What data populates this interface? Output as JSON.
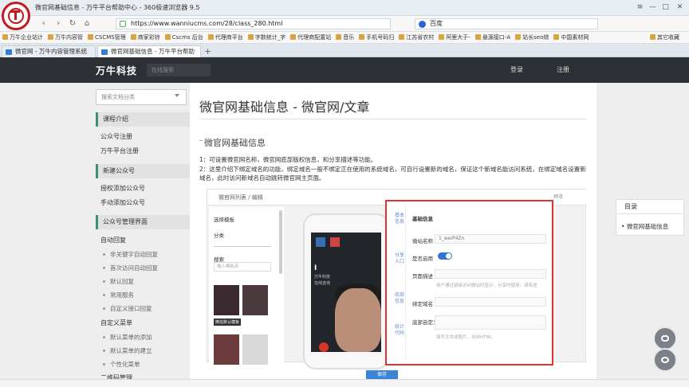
{
  "window": {
    "title": "微官网基础信息 - 万牛平台帮助中心 - 360极速浏览器 9.5",
    "menu_icon": "≡",
    "minimize": "—",
    "maximize": "□",
    "close": "✕"
  },
  "nav": {
    "url": "https://www.wanniucms.com/28/class_280.html",
    "search_engine": "百度",
    "back": "‹",
    "forward": "›",
    "reload": "↻",
    "home": "⌂"
  },
  "bookmarks": [
    "万牛企业站计",
    "万牛内容管",
    "CSCMS管理",
    "商家彩铃",
    "Cscms 后台",
    "代理商平台",
    "字数统计_字",
    "代理商配置站",
    "音乐",
    "手机号码归",
    "江苏省农村",
    "阿里大于-",
    "悬源接口-A",
    "站长seo综",
    "中国素材网",
    "其它收藏"
  ],
  "tabs": [
    "微官网 - 万牛内容管理系统",
    "微官网基础信息 - 万牛平台帮助"
  ],
  "site": {
    "brand": "万牛科技",
    "search_placeholder": "在线搜索",
    "login": "登录",
    "register": "注册"
  },
  "sidebar": {
    "category_select": "搜索文档分类",
    "sections": [
      {
        "title": "课程介绍",
        "items": [
          "公众号注册",
          "万牛平台注册"
        ]
      },
      {
        "title": "新建公众号",
        "items": [
          "授权添加公众号",
          "手动添加公众号"
        ]
      },
      {
        "title": "公众号管理界面",
        "items": []
      }
    ],
    "auto_reply": "自动回复",
    "auto_reply_items": [
      "非关键字自动回复",
      "首次访问自动回复",
      "默认回复",
      "常用服务",
      "自定义接口回复"
    ],
    "custom_menu": "自定义菜单",
    "custom_menu_items": [
      "默认菜单的添加",
      "默认菜单的建立",
      "个性化菜单"
    ],
    "more": "二维码管理"
  },
  "main": {
    "title": "微官网基础信息 - 微官网/文章",
    "section": "微官网基础信息",
    "para1": "1：可设置微官网名称，微官网底部版权信息，和分享描述等功能。",
    "para2": "2：这里介绍下绑定域名的功能，绑定域名一般不绑定正在使用的系统域名，可自行设置新的域名，保证这个新域名能访问系统，在绑定域名设置新域名，此时访问新域名自动跳转微官网主页面。"
  },
  "shot": {
    "crumb": "微官网列表 / 编辑",
    "choose_template": "选择模板",
    "category": "分类",
    "search": "搜索",
    "search_placeholder": "输入模板名",
    "template_name": "微信默认模板",
    "phone_caption": "万牛科技",
    "phone_subcaption": "在线咨询",
    "side_tabs": [
      "基本信息",
      "分享入口",
      "底部信息",
      "统计代码",
      "高级设置"
    ],
    "form_title": "基础信息",
    "fields": {
      "name_label": "微站名称",
      "name_value": "1_weiP4Zn",
      "open_label": "是否启用",
      "footer_label": "页面描述",
      "footer_hint": "用户通过链接访问微站时显示，分享时使用，请简述",
      "domain_label": "绑定域名",
      "code_label": "底部自定义",
      "code_hint": "填写文本或图片，支持HTML"
    },
    "save": "保存",
    "preview": "预览"
  },
  "toc": {
    "title": "目录",
    "item": "微官网基础信息"
  },
  "colors": {
    "accent": "#3f8f74",
    "highlight": "#e0342f",
    "header": "#2c2f33"
  },
  "icons": [
    "logo-icon",
    "chat-icon",
    "comment-icon",
    "lock-icon",
    "search-icon"
  ]
}
